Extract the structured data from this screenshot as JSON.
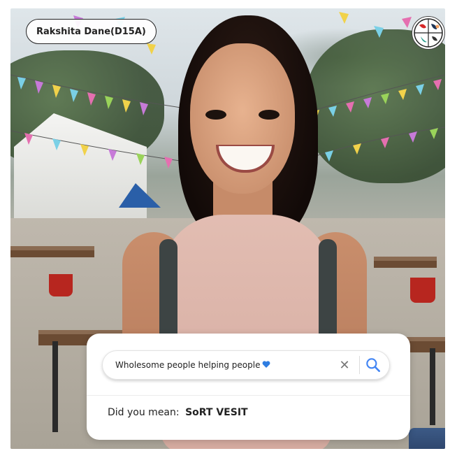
{
  "badge": {
    "name": "Rakshita Dane(D15A)"
  },
  "logo": {
    "icon": "club-logo-icon"
  },
  "search": {
    "query": "Wholesome people helping people",
    "query_emoji": "blue-heart-icon",
    "clear_icon": "close-icon",
    "search_icon": "search-icon"
  },
  "suggestion": {
    "prefix": "Did you mean:",
    "term": "SoRT VESIT"
  },
  "colors": {
    "accent_blue": "#4285f4",
    "heart_blue": "#2f7de1",
    "badge_border": "#222222"
  }
}
